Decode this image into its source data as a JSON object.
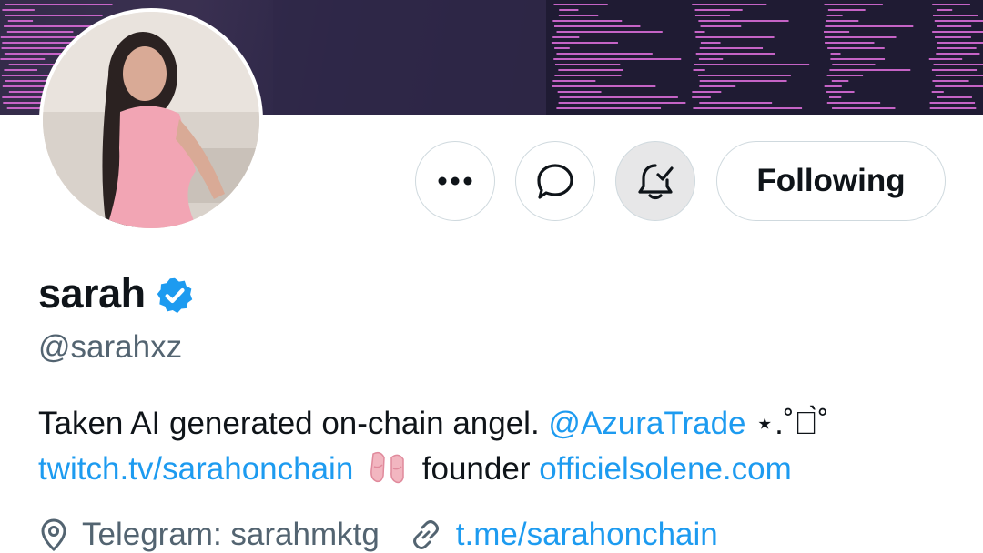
{
  "profile": {
    "display_name": "sarah",
    "handle": "@sarahxz",
    "bio": {
      "line1_text": "Taken AI generated on-chain angel.",
      "line1_mention": "@AzuraTrade",
      "line1_decor": "⋆.˚๋̀˚",
      "line2_link1": "twitch.tv/sarahonchain",
      "line2_text": "founder",
      "line2_link2": "officielsolene.com"
    },
    "location": "Telegram: sarahmktg",
    "website": "t.me/sarahonchain"
  },
  "actions": {
    "more_icon": "more-horizontal-icon",
    "message_icon": "chat-bubble-icon",
    "notify_icon": "bell-check-icon",
    "follow_label": "Following"
  },
  "colors": {
    "link": "#1d9bf0",
    "secondary_text": "#536471",
    "verified": "#1d9bf0",
    "banner": "#2a2440",
    "banner_code": "#d867d8"
  },
  "icons": {
    "verified": "verified-badge-icon",
    "location": "location-pin-icon",
    "link": "link-icon",
    "bio_emoji": "ballet-shoes-emoji"
  }
}
